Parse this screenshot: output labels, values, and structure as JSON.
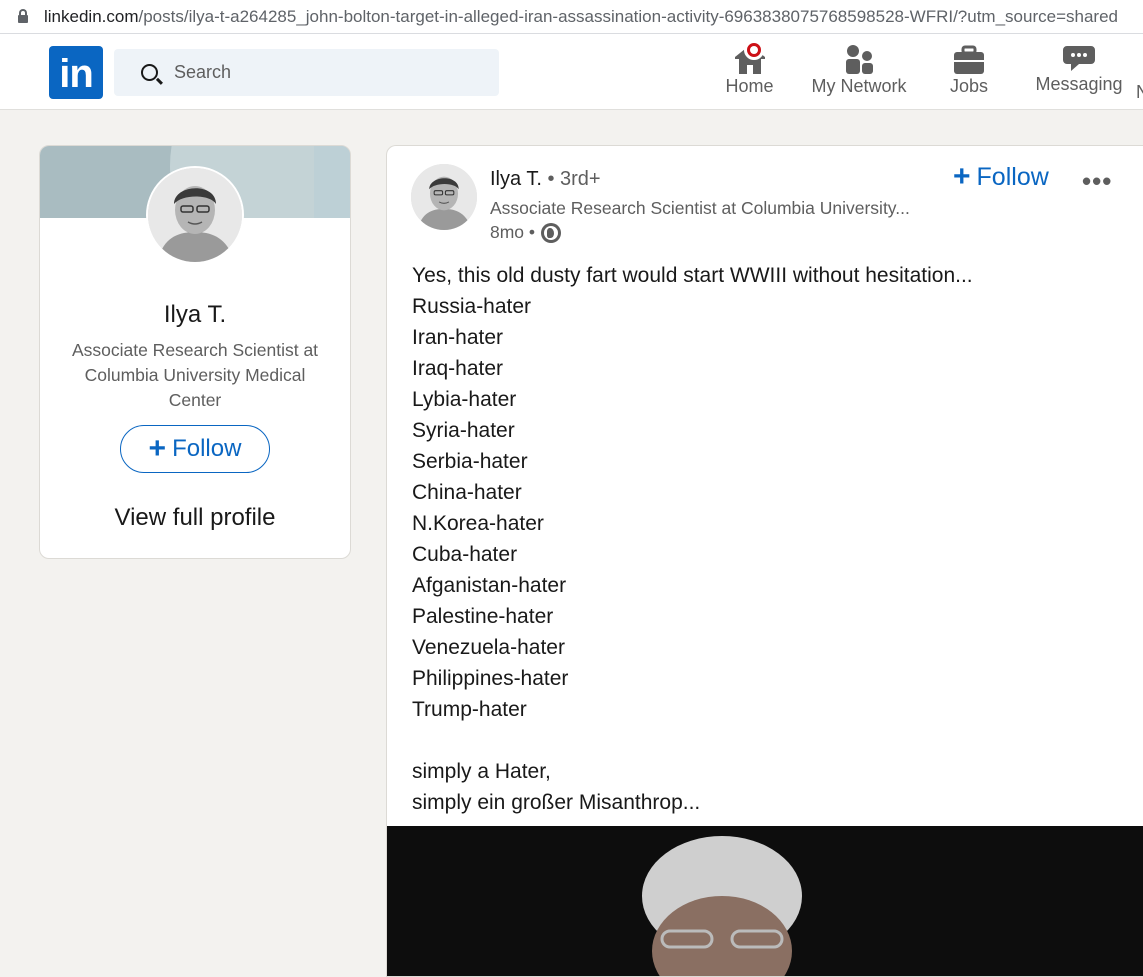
{
  "browser": {
    "url_host": "linkedin.com",
    "url_path": "/posts/ilya-t-a264285_john-bolton-target-in-alleged-iran-assassination-activity-6963838075768598528-WFRI/?utm_source=shared"
  },
  "nav": {
    "logo": "in",
    "search_placeholder": "Search",
    "items": [
      {
        "label": "Home",
        "icon": "home-icon"
      },
      {
        "label": "My Network",
        "icon": "network-icon"
      },
      {
        "label": "Jobs",
        "icon": "briefcase-icon"
      },
      {
        "label": "Messaging",
        "icon": "messaging-icon"
      }
    ],
    "overflow_letter": "N"
  },
  "profile_card": {
    "name": "Ilya T.",
    "headline": "Associate Research Scientist at Columbia University Medical Center",
    "follow_label": "Follow",
    "view_profile_label": "View full profile"
  },
  "post": {
    "author": "Ilya T.",
    "degree": "• 3rd+",
    "headline": "Associate Research Scientist at Columbia University...",
    "time": "8mo •",
    "follow_label": "Follow",
    "more_label": "•••",
    "lines": [
      "Yes, this old dusty fart would start WWIII without hesitation...",
      "Russia-hater",
      "Iran-hater",
      "Iraq-hater",
      "Lybia-hater",
      "Syria-hater",
      "Serbia-hater",
      "China-hater",
      "N.Korea-hater",
      "Cuba-hater",
      "Afganistan-hater",
      "Palestine-hater",
      "Venezuela-hater",
      "Philippines-hater",
      "Trump-hater",
      "",
      "simply a Hater,",
      "simply ein großer Misanthrop..."
    ]
  },
  "colors": {
    "brand": "#0a66c2",
    "notification": "#cc1016",
    "page_bg": "#f3f2ef"
  }
}
